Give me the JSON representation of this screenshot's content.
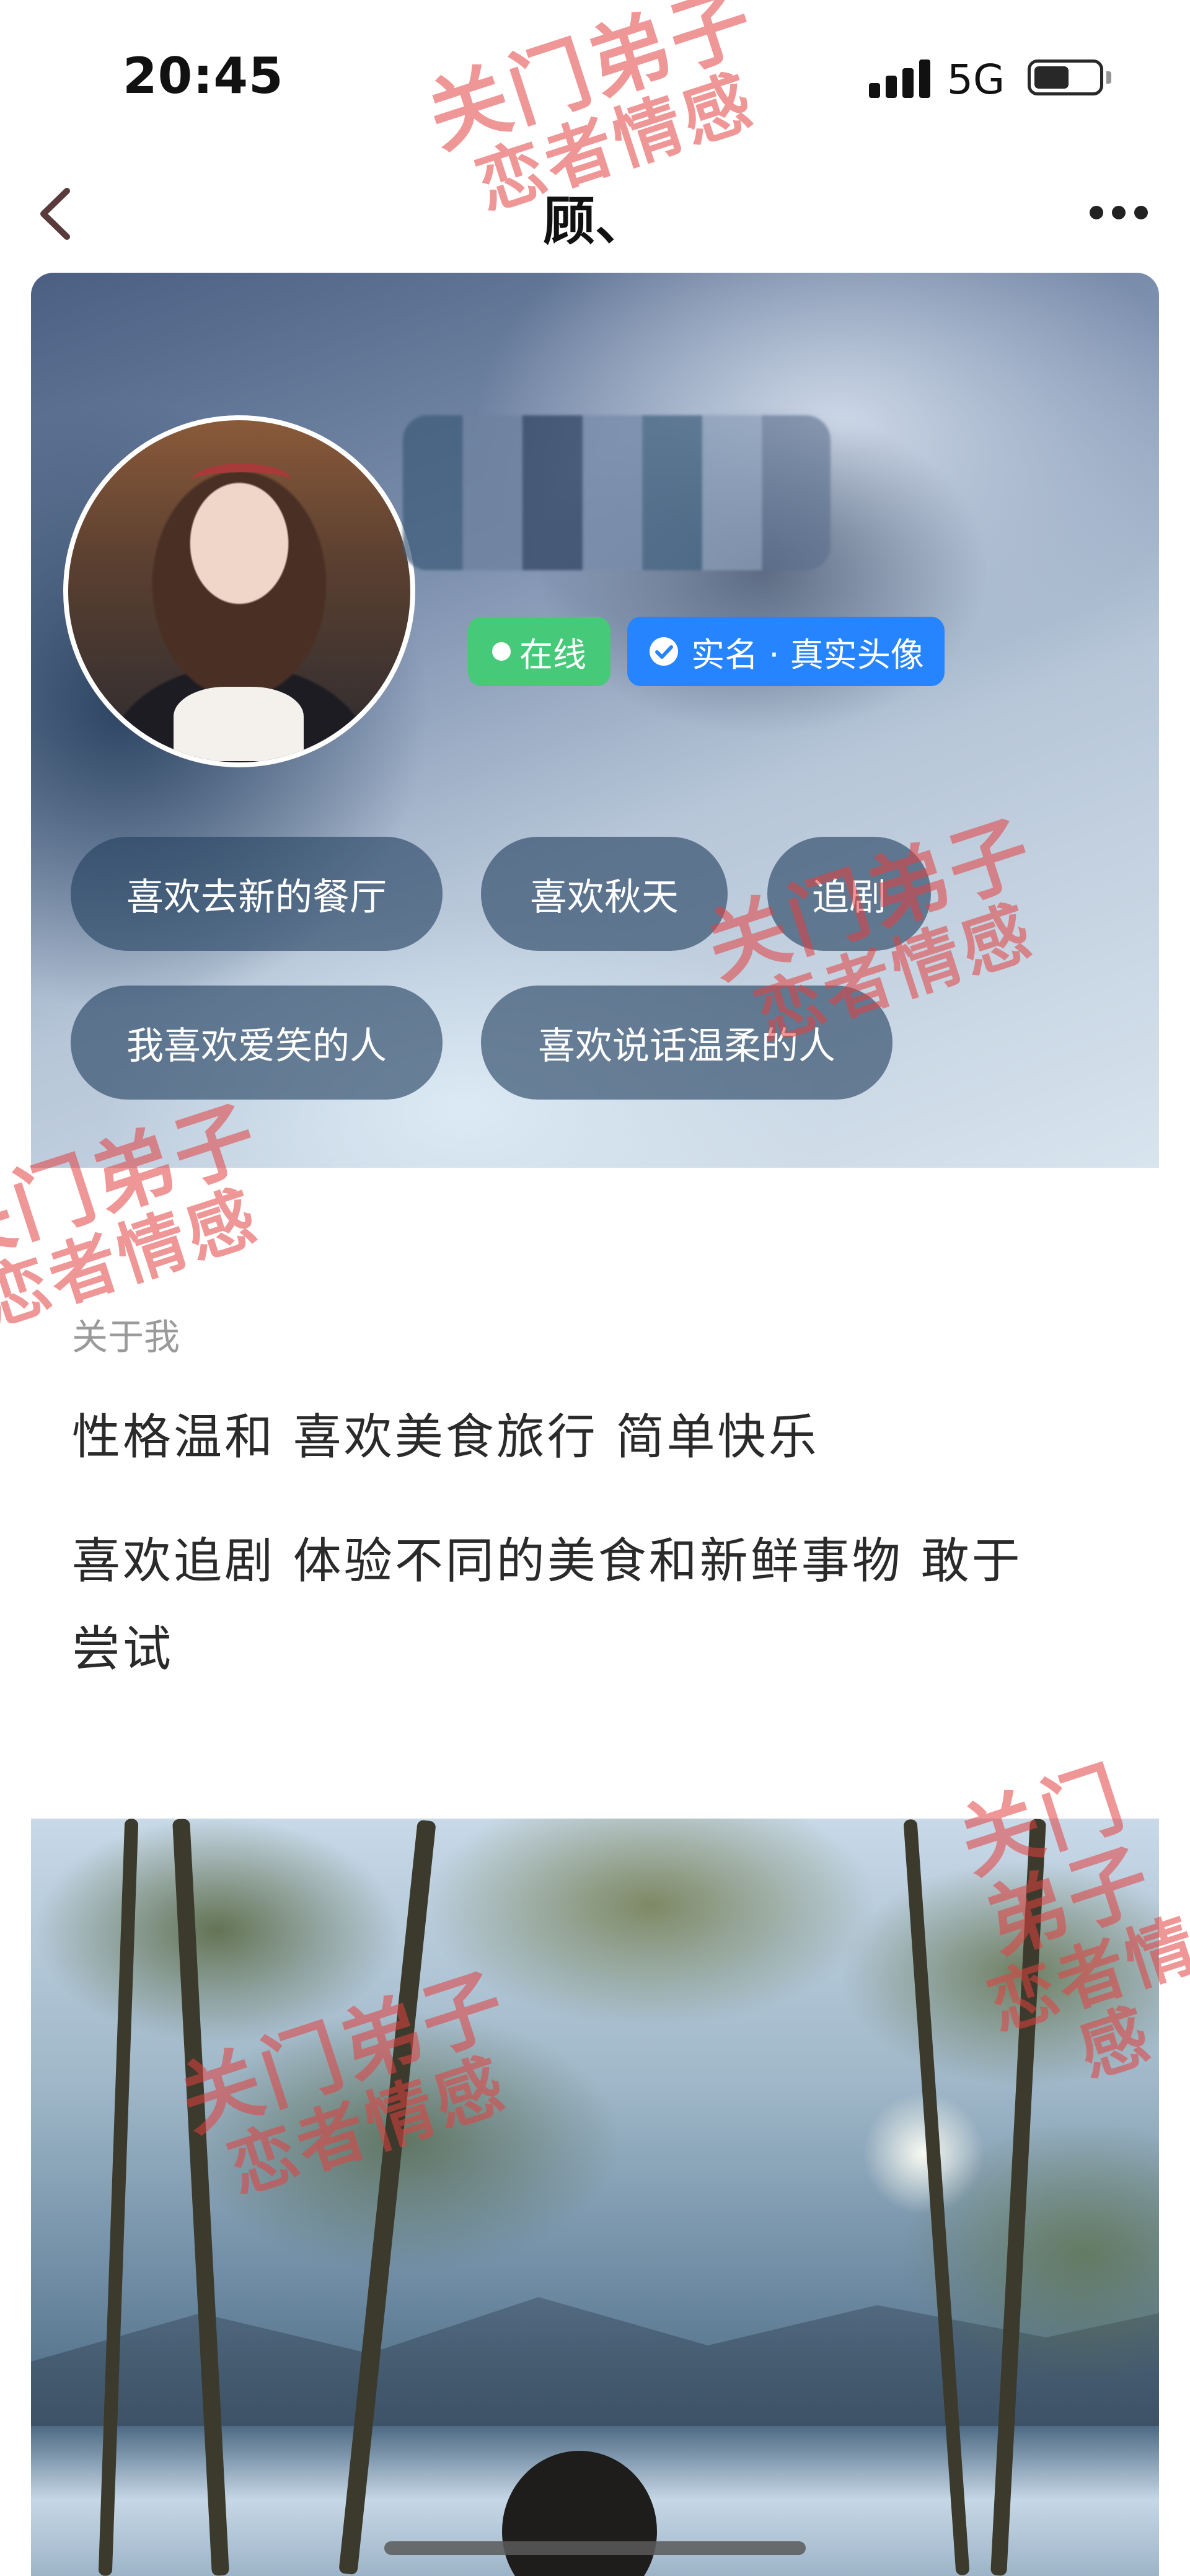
{
  "status_bar": {
    "time": "20:45",
    "network": "5G",
    "signal_bars": 4,
    "battery_level": 0.55
  },
  "nav": {
    "title": "顾、",
    "back_icon": "chevron-left-icon",
    "more_icon": "more-dots-icon"
  },
  "profile": {
    "online_badge": "在线",
    "verified_badge": "实名 · 真实头像",
    "verified_icon": "check-circle-icon",
    "tags": [
      "喜欢去新的餐厅",
      "喜欢秋天",
      "追剧",
      "我喜欢爱笑的人",
      "喜欢说话温柔的人"
    ]
  },
  "about": {
    "heading": "关于我",
    "lines": [
      "性格温和 喜欢美食旅行 简单快乐",
      "喜欢追剧 体验不同的美食和新鲜事物 敢于",
      "尝试"
    ]
  },
  "watermark": {
    "line1": "关门弟子",
    "line2": "恋者情感"
  },
  "colors": {
    "online": "#46c978",
    "verified": "#2784ff",
    "watermark": "#e24040"
  }
}
